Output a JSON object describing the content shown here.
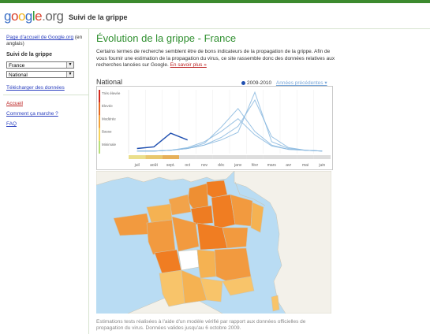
{
  "header": {
    "logo_text": "google.org",
    "site_title": "Suivi de la grippe"
  },
  "sidebar": {
    "home_link": "Page d'accueil de Google.org",
    "home_suffix": " (en anglais)",
    "section_heading": "Suivi de la grippe",
    "country_select": "France",
    "region_select": "National",
    "download_link": "Télécharger des données",
    "nav": [
      {
        "label": "Accueil",
        "active": true
      },
      {
        "label": "Comment ça marche ?",
        "active": false
      },
      {
        "label": "FAQ",
        "active": false
      }
    ]
  },
  "main": {
    "title": "Évolution de la grippe - France",
    "intro": "Certains termes de recherche semblent être de bons indicateurs de la propagation de la grippe. Afin de vous fournir une estimation de la propagation du virus, ce site rassemble donc des données relatives aux recherches lancées sur Google.",
    "learn_more": "En savoir plus »",
    "chart_heading": "National",
    "legend_current": "2009-2010",
    "legend_previous": "Années précédentes ▾",
    "footnote": "Estimations tests réalisées à l'aide d'un modèle vérifié par rapport aux données officielles de propagation du virus. Données valides jusqu'au 6 octobre 2009."
  },
  "colors": {
    "current_series": "#1f4fb0",
    "previous_series": "#8ab8df",
    "title_green": "#2f8f2f",
    "link_blue": "#2a3fbf",
    "link_red": "#b22222",
    "map_sea": "#b9dcf3"
  },
  "chart_data": {
    "type": "line",
    "levels": [
      "Très élevée",
      "Élevée",
      "Modérée",
      "Basse",
      "Minimale"
    ],
    "categories": [
      "juil",
      "août",
      "sept.",
      "oct",
      "nov",
      "déc",
      "janv",
      "févr",
      "mars",
      "avr",
      "mai",
      "juin"
    ],
    "series": [
      {
        "name": "2009-2010",
        "values": [
          0.6,
          0.8,
          2.4,
          1.6,
          null,
          null,
          null,
          null,
          null,
          null,
          null,
          null
        ]
      },
      {
        "values": [
          0.3,
          0.3,
          0.4,
          0.7,
          1.4,
          2.6,
          4.1,
          2.2,
          0.9,
          0.5,
          0.4,
          0.3
        ]
      },
      {
        "values": [
          0.3,
          0.3,
          0.4,
          0.6,
          1.2,
          3.1,
          5.3,
          2.6,
          1.0,
          0.5,
          0.4,
          0.3
        ]
      },
      {
        "values": [
          0.3,
          0.3,
          0.4,
          0.6,
          1.0,
          1.9,
          3.2,
          6.3,
          2.0,
          0.7,
          0.4,
          0.3
        ]
      },
      {
        "values": [
          0.3,
          0.3,
          0.4,
          0.6,
          1.0,
          1.6,
          2.5,
          7.2,
          1.4,
          0.6,
          0.4,
          0.3
        ]
      }
    ],
    "ylim": [
      0,
      7.5
    ]
  },
  "map": {
    "regions": [
      {
        "name": "Nord-Pas-de-Calais",
        "level": "high"
      },
      {
        "name": "Picardie",
        "level": "high"
      },
      {
        "name": "Haute-Normandie",
        "level": "medium-high"
      },
      {
        "name": "Île-de-France",
        "level": "high"
      },
      {
        "name": "Champagne-Ardenne",
        "level": "high"
      },
      {
        "name": "Lorraine",
        "level": "medium-high"
      },
      {
        "name": "Alsace",
        "level": "medium"
      },
      {
        "name": "Basse-Normandie",
        "level": "medium"
      },
      {
        "name": "Bretagne",
        "level": "medium-high"
      },
      {
        "name": "Pays de la Loire",
        "level": "medium-high"
      },
      {
        "name": "Centre",
        "level": "medium-high"
      },
      {
        "name": "Bourgogne",
        "level": "high"
      },
      {
        "name": "Franche-Comté",
        "level": "medium-high"
      },
      {
        "name": "Poitou-Charentes",
        "level": "high"
      },
      {
        "name": "Limousin",
        "level": "none"
      },
      {
        "name": "Auvergne",
        "level": "medium"
      },
      {
        "name": "Rhône-Alpes",
        "level": "medium-high"
      },
      {
        "name": "Aquitaine",
        "level": "low"
      },
      {
        "name": "Midi-Pyrénées",
        "level": "medium"
      },
      {
        "name": "Languedoc-Roussillon",
        "level": "low"
      },
      {
        "name": "Provence-Alpes-Côte d'Azur",
        "level": "low"
      },
      {
        "name": "Corse",
        "level": "low"
      }
    ]
  }
}
